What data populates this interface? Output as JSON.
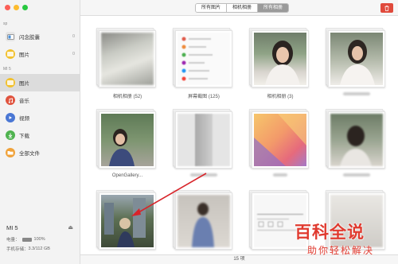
{
  "sidebar": {
    "section_top": "sp",
    "top_items": [
      {
        "label": "闪念胶囊",
        "count": "0",
        "icon": "capsule-icon"
      },
      {
        "label": "图片",
        "count": "0",
        "icon": "photos-icon"
      }
    ],
    "section_device": "MI 5",
    "device_items": [
      {
        "label": "图片",
        "icon": "photos-icon",
        "color": "#f2c12e"
      },
      {
        "label": "音乐",
        "icon": "music-icon",
        "color": "#e0533e"
      },
      {
        "label": "视频",
        "icon": "video-icon",
        "color": "#4a77d4"
      },
      {
        "label": "下载",
        "icon": "download-icon",
        "color": "#4fb34f"
      },
      {
        "label": "全部文件",
        "icon": "folder-icon",
        "color": "#f0a23a"
      }
    ],
    "device": {
      "name": "MI 5",
      "battery_label": "电量：",
      "battery_value": "100%",
      "storage_label": "手机存储：",
      "storage_value": "3.3/112 GB"
    }
  },
  "toolbar": {
    "tabs": [
      "所有图片",
      "相机相册",
      "所有相册"
    ],
    "active_tab": "所有相册",
    "delete_icon": "trash-icon"
  },
  "albums": [
    {
      "caption": "相机相册 (52)"
    },
    {
      "caption": "屏幕截图 (125)"
    },
    {
      "caption": "相机相册 (3)"
    },
    {
      "caption": ""
    },
    {
      "caption": "OpenGallery..."
    },
    {
      "caption": ""
    },
    {
      "caption": ""
    },
    {
      "caption": ""
    },
    {
      "caption": ""
    },
    {
      "caption": ""
    },
    {
      "caption": ""
    },
    {
      "caption": ""
    }
  ],
  "footer": {
    "count": "15 项"
  },
  "watermark": {
    "big": "百科全说",
    "small": "助你轻松解决"
  },
  "colors": {
    "accent_red": "#e03a2f",
    "delete_red": "#e04a3c"
  }
}
